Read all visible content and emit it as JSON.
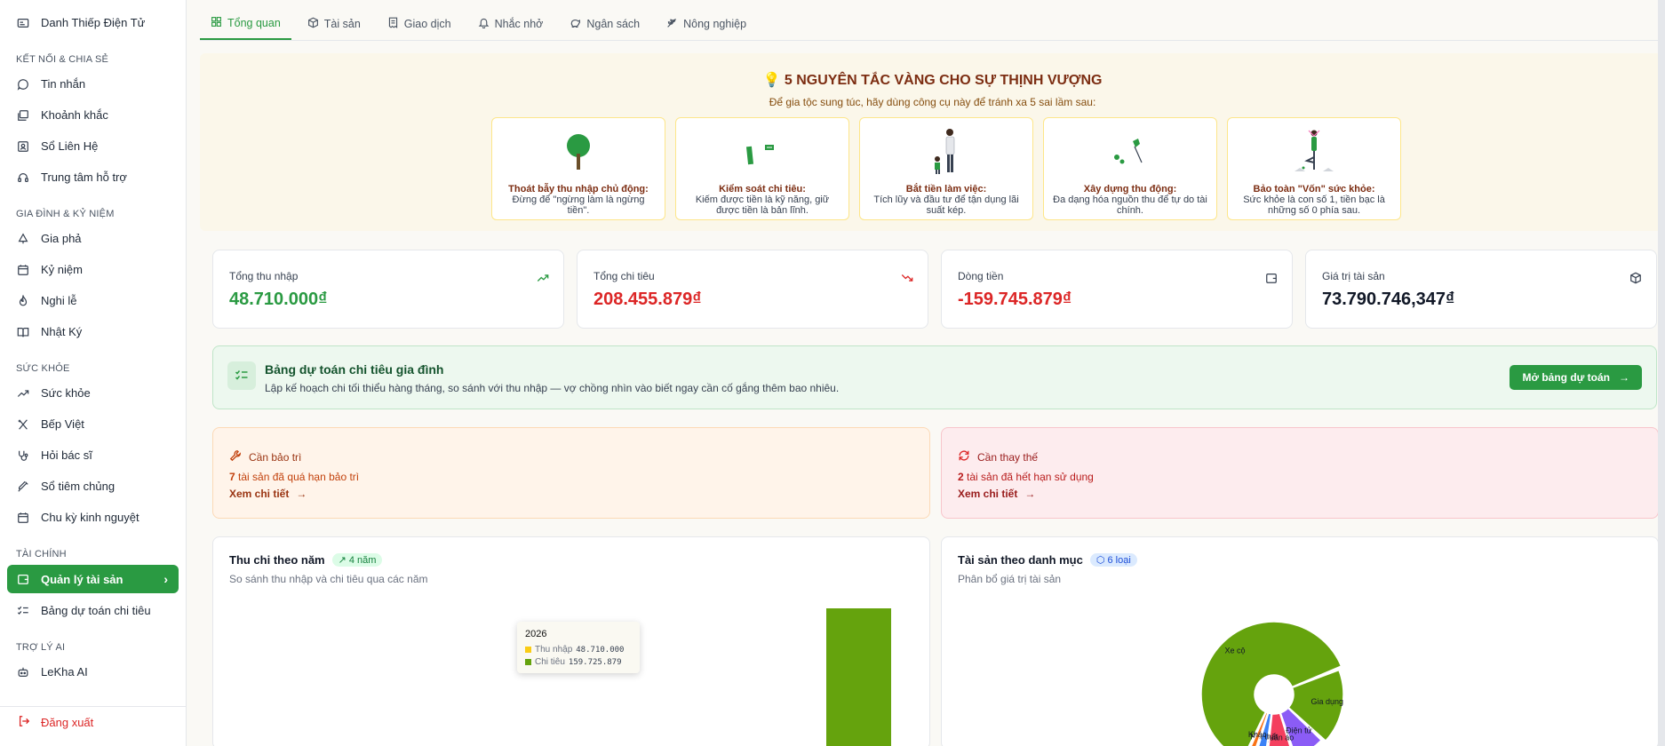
{
  "sidebar": {
    "top_item": "Danh Thiếp Điện Tử",
    "sections": [
      {
        "title": "KẾT NỐI & CHIA SẺ",
        "items": [
          "Tin nhắn",
          "Khoảnh khắc",
          "Sổ Liên Hệ",
          "Trung tâm hỗ trợ"
        ]
      },
      {
        "title": "GIA ĐÌNH & KỶ NIỆM",
        "items": [
          "Gia phả",
          "Kỷ niệm",
          "Nghi lễ",
          "Nhật Ký"
        ]
      },
      {
        "title": "SỨC KHỎE",
        "items": [
          "Sức khỏe",
          "Bếp Việt",
          "Hỏi bác sĩ",
          "Sổ tiêm chủng",
          "Chu kỳ kinh nguyệt"
        ]
      },
      {
        "title": "TÀI CHÍNH",
        "items": [
          "Quản lý tài sản",
          "Bảng dự toán chi tiêu"
        ]
      },
      {
        "title": "TRỢ LÝ AI",
        "items": [
          "LeKha AI"
        ]
      }
    ],
    "logout": "Đăng xuất"
  },
  "tabs": [
    "Tổng quan",
    "Tài sản",
    "Giao dịch",
    "Nhắc nhở",
    "Ngân sách",
    "Nông nghiệp"
  ],
  "golden": {
    "title": "💡 5 NGUYÊN TẮC VÀNG CHO SỰ THỊNH VƯỢNG",
    "subtitle": "Để gia tộc sung túc, hãy dùng công cụ này để tránh xa 5 sai lầm sau:",
    "cards": [
      {
        "title": "Thoát bẫy thu nhập chủ động:",
        "desc": "Đừng để \"ngừng làm là ngừng tiền\"."
      },
      {
        "title": "Kiểm soát chi tiêu:",
        "desc": "Kiếm được tiền là kỹ năng, giữ được tiền là bản lĩnh."
      },
      {
        "title": "Bắt tiền làm việc:",
        "desc": "Tích lũy và đầu tư để tận dụng lãi suất kép."
      },
      {
        "title": "Xây dựng thu động:",
        "desc": "Đa dạng hóa nguồn thu để tự do tài chính."
      },
      {
        "title": "Bảo toàn \"Vốn\" sức khỏe:",
        "desc": "Sức khỏe là con số 1, tiền bạc là những số 0 phía sau."
      }
    ]
  },
  "stats": [
    {
      "label": "Tổng thu nhập",
      "value": "48.710.000₫",
      "color": "#2a9a42"
    },
    {
      "label": "Tổng chi tiêu",
      "value": "208.455.879₫",
      "color": "#dc2626"
    },
    {
      "label": "Dòng tiền",
      "value": "-159.745.879₫",
      "color": "#dc2626"
    },
    {
      "label": "Giá trị tài sản",
      "value": "73.790.746,347₫",
      "color": "#111827"
    }
  ],
  "budget": {
    "title": "Bảng dự toán chi tiêu gia đình",
    "desc": "Lập kế hoạch chi tối thiểu hàng tháng, so sánh với thu nhập — vợ chồng nhìn vào biết ngay cần cố gắng thêm bao nhiêu.",
    "button": "Mở bảng dự toán"
  },
  "alerts": [
    {
      "title": "Cần bảo trì",
      "count": "7",
      "desc": "tài sản đã quá hạn bảo trì",
      "link": "Xem chi tiết"
    },
    {
      "title": "Cần thay thế",
      "count": "2",
      "desc": "tài sản đã hết hạn sử dụng",
      "link": "Xem chi tiết"
    }
  ],
  "panel_left": {
    "title": "Thu chi theo năm",
    "badge": "4 năm",
    "subtitle": "So sánh thu nhập và chi tiêu qua các năm",
    "tooltip": {
      "year": "2026",
      "income_label": "Thu nhập",
      "income_value": "48.710.000",
      "expense_label": "Chi tiêu",
      "expense_value": "159.725.879"
    }
  },
  "panel_right": {
    "title": "Tài sản theo danh mục",
    "badge": "6 loại",
    "subtitle": "Phân bổ giá trị tài sản",
    "labels": [
      "Điện tử",
      "Quần áo",
      "Nội thất",
      "Khác",
      "Gia dụng",
      "Xe cộ"
    ]
  },
  "chart_data": [
    {
      "type": "bar",
      "title": "Thu chi theo năm",
      "categories": [
        "2026"
      ],
      "series": [
        {
          "name": "Thu nhập",
          "values": [
            48710000
          ]
        },
        {
          "name": "Chi tiêu",
          "values": [
            159725879
          ]
        }
      ]
    },
    {
      "type": "pie",
      "title": "Tài sản theo danh mục",
      "categories": [
        "Xe cộ",
        "Gia dụng",
        "Điện tử",
        "Quần áo",
        "Nội thất",
        "Khác"
      ],
      "values": [
        62,
        18,
        8,
        7,
        3,
        2
      ]
    }
  ],
  "colors": {
    "brand": "#2a9a42",
    "danger": "#dc2626",
    "income": "#facc15",
    "expense": "#65a30d"
  }
}
